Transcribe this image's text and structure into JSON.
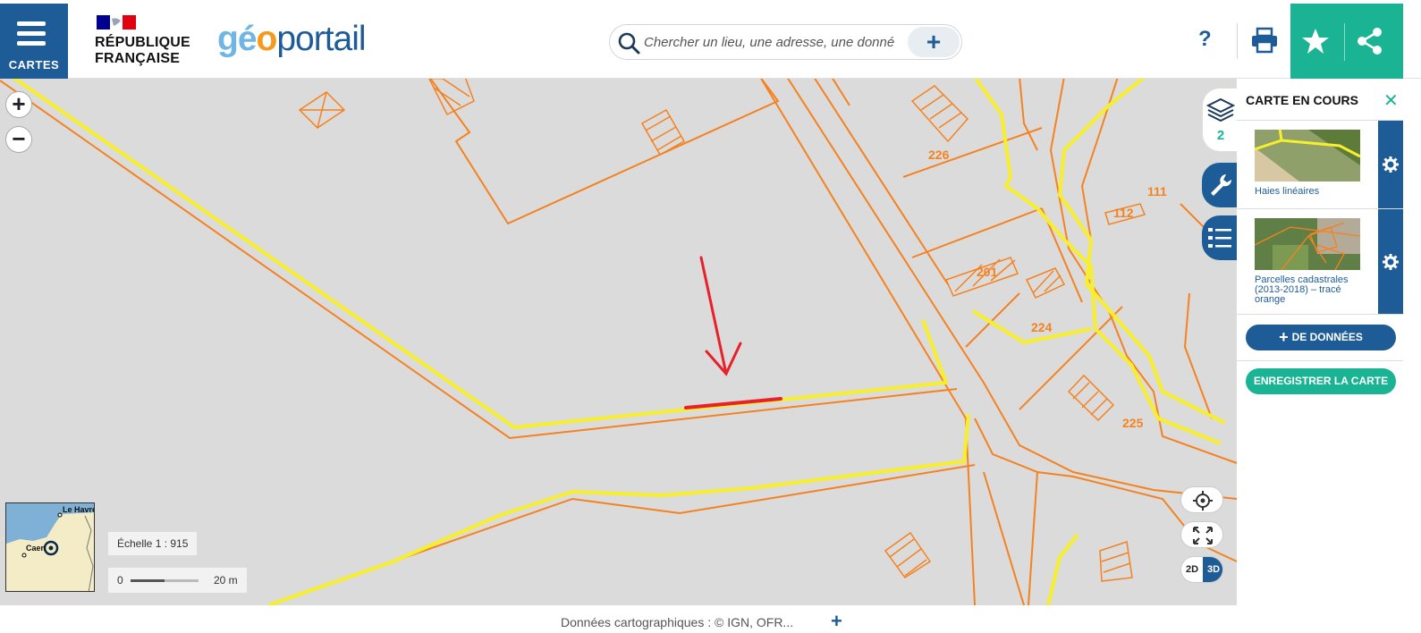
{
  "header": {
    "menu_label": "CARTES",
    "republic_line1": "RÉPUBLIQUE",
    "republic_line2": "FRANÇAISE",
    "logo_part1": "gé",
    "logo_part2": "o",
    "logo_part3": "portail",
    "search_placeholder": "Chercher un lieu, une adresse, une donnée",
    "search_plus": "+",
    "help_label": "?"
  },
  "map": {
    "zoom_in": "+",
    "zoom_out": "−",
    "parcel_labels": [
      "226",
      "111",
      "112",
      "201",
      "224",
      "225"
    ],
    "minimap_labels": [
      "Le Havre",
      "Caen"
    ],
    "scale_text": "Échelle 1 : 915",
    "scale_zero": "0",
    "scale_distance": "20 m",
    "btn_2d": "2D",
    "btn_3d": "3D",
    "colors": {
      "parcel": "#f58220",
      "hedge": "#f7ef2c",
      "annotation": "#e8202a",
      "background": "#dbdbdb"
    }
  },
  "sidebar": {
    "layers_count": "2"
  },
  "panel": {
    "title": "CARTE EN COURS",
    "close": "✕",
    "layers": [
      {
        "name": "Haies linéaires"
      },
      {
        "name": "Parcelles cadastrales (2013-2018) – tracé orange"
      }
    ],
    "add_data_label": "DE DONNÉES",
    "save_map_label": "ENREGISTRER LA CARTE"
  },
  "footer": {
    "credits": "Données cartographiques : © IGN, OFR...",
    "plus": "+"
  }
}
